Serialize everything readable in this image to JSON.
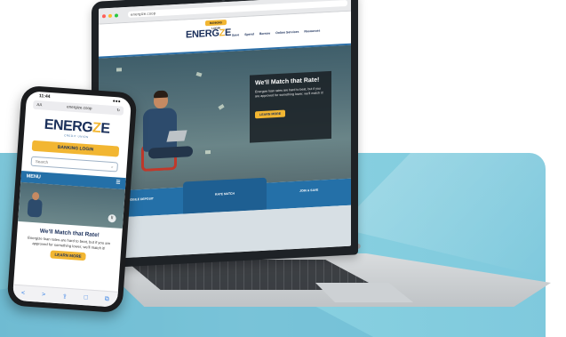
{
  "laptop": {
    "browser": {
      "url": "energize.coop",
      "dot_colors": [
        "#ff5f57",
        "#febc2e",
        "#28c840"
      ]
    },
    "site": {
      "login_chip": "BANKING LOGIN",
      "logo": "ENERG",
      "logo_bolt": "Z",
      "logo_end": "E",
      "nav": [
        "Save",
        "Spend",
        "Borrow",
        "Online Services",
        "Resources"
      ]
    },
    "hero": {
      "title": "We'll Match that Rate!",
      "body": "Energize loan rates are hard to beat, but if you are approved for something lower, we'll match it!",
      "cta": "LEARN MORE"
    },
    "strip": [
      "MOBILE DEPOSIT",
      "RATE MATCH",
      "JOIN & SAVE"
    ]
  },
  "phone": {
    "time": "11:44",
    "signal": "●●●",
    "url": "energize.coop",
    "url_prefix": "AA",
    "logo": "ENERG",
    "logo_bolt": "Z",
    "logo_end": "E",
    "tagline": "CREDIT UNION",
    "banking_button": "BANKING LOGIN",
    "search_placeholder": "Search",
    "search_icon": "⌕",
    "menu_label": "MENU",
    "menu_icon": "☰",
    "pause_icon": "II",
    "hero_title": "We'll Match that Rate!",
    "hero_body": "Energize loan rates are hard to beat, but if you are approved for something lower, we'll match it!",
    "cta": "LEARN MORE",
    "toolbar_icons": [
      "<",
      ">",
      "⇪",
      "□",
      "⧉"
    ]
  },
  "colors": {
    "brand_navy": "#1a2f5a",
    "brand_yellow": "#f2b632",
    "brand_blue": "#2470a8",
    "background_teal": "#8ad2e1"
  }
}
